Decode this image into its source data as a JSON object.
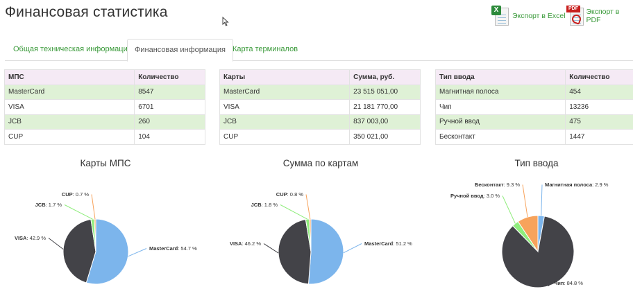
{
  "header": {
    "title": "Финансовая статистика",
    "export_excel": "Экспорт в Excel",
    "export_pdf": "Экспорт в PDF",
    "excel_badge": "X",
    "pdf_badge": "PDF"
  },
  "tabs": [
    {
      "label": "Общая техническая информация",
      "active": false
    },
    {
      "label": "Финансовая информация",
      "active": true
    },
    {
      "label": "Карта терминалов",
      "active": false
    }
  ],
  "tables": [
    {
      "headers": [
        "МПС",
        "Количество"
      ],
      "rows": [
        [
          "MasterCard",
          "8547"
        ],
        [
          "VISA",
          "6701"
        ],
        [
          "JCB",
          "260"
        ],
        [
          "CUP",
          "104"
        ]
      ]
    },
    {
      "headers": [
        "Карты",
        "Сумма, руб."
      ],
      "rows": [
        [
          "MasterCard",
          "23 515 051,00"
        ],
        [
          "VISA",
          "21 181 770,00"
        ],
        [
          "JCB",
          "837 003,00"
        ],
        [
          "CUP",
          "350 021,00"
        ]
      ]
    },
    {
      "headers": [
        "Тип ввода",
        "Количество"
      ],
      "rows": [
        [
          "Магнитная полоса",
          "454"
        ],
        [
          "Чип",
          "13236"
        ],
        [
          "Ручной ввод",
          "475"
        ],
        [
          "Бесконтакт",
          "1447"
        ]
      ]
    }
  ],
  "chart_data": [
    {
      "type": "pie",
      "title": "Карты МПС",
      "slices": [
        {
          "name": "MasterCard",
          "value": 54.7,
          "label": "54.7 %",
          "color": "#7cb5ec"
        },
        {
          "name": "VISA",
          "value": 42.9,
          "label": "42.9 %",
          "color": "#434348"
        },
        {
          "name": "JCB",
          "value": 1.7,
          "label": "1.7 %",
          "color": "#90ed7d"
        },
        {
          "name": "CUP",
          "value": 0.7,
          "label": "0.7 %",
          "color": "#f7a35c"
        }
      ]
    },
    {
      "type": "pie",
      "title": "Сумма по картам",
      "slices": [
        {
          "name": "MasterCard",
          "value": 51.2,
          "label": "51.2 %",
          "color": "#7cb5ec"
        },
        {
          "name": "VISA",
          "value": 46.2,
          "label": "46.2 %",
          "color": "#434348"
        },
        {
          "name": "JCB",
          "value": 1.8,
          "label": "1.8 %",
          "color": "#90ed7d"
        },
        {
          "name": "CUP",
          "value": 0.8,
          "label": "0.8 %",
          "color": "#f7a35c"
        }
      ]
    },
    {
      "type": "pie",
      "title": "Тип ввода",
      "slices": [
        {
          "name": "Магнитная полоса",
          "value": 2.9,
          "label": "2.9 %",
          "color": "#7cb5ec"
        },
        {
          "name": "Чип",
          "value": 84.8,
          "label": "84.8 %",
          "color": "#434348"
        },
        {
          "name": "Ручной ввод",
          "value": 3.0,
          "label": "3.0 %",
          "color": "#90ed7d"
        },
        {
          "name": "Бесконтакт",
          "value": 9.3,
          "label": "9.3 %",
          "color": "#f7a35c"
        }
      ]
    }
  ]
}
